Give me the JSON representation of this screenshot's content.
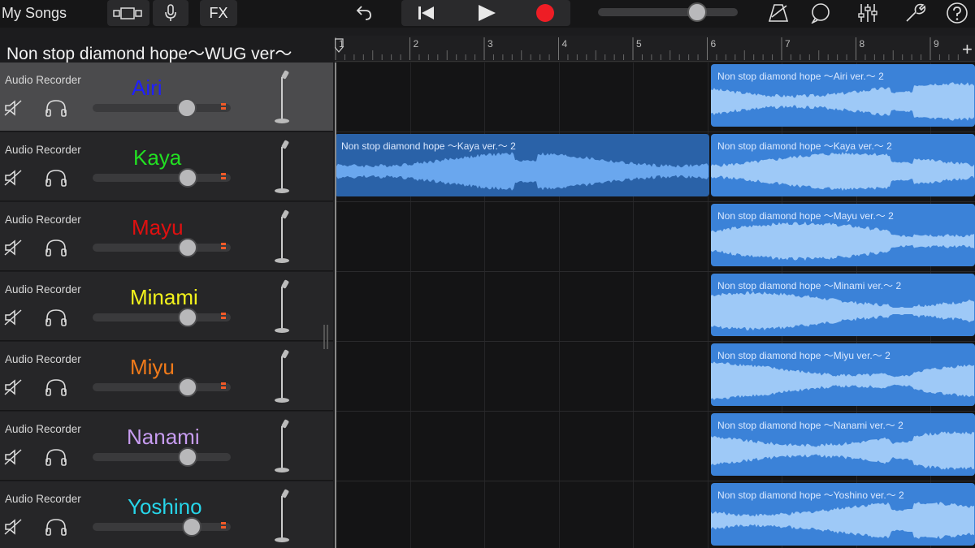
{
  "toolbar": {
    "my_songs": "My Songs",
    "fx": "FX",
    "master_volume": 0.71,
    "icons": [
      "views-icon",
      "mic-icon",
      "undo-icon",
      "go-to-start-icon",
      "play-icon",
      "record-icon",
      "metronome-icon",
      "loop-icon",
      "mixer-icon",
      "wrench-icon",
      "help-icon"
    ]
  },
  "song": {
    "title": "Non stop diamond hope〜WUG ver〜"
  },
  "ruler": {
    "bars": [
      "1",
      "2",
      "3",
      "4",
      "5",
      "6",
      "7",
      "8",
      "9"
    ],
    "add_label": "+"
  },
  "tracks": [
    {
      "type": "Audio Recorder",
      "name": "Airi",
      "name_color": "#1f1fff",
      "volume": 0.68,
      "meter": true,
      "selected": true
    },
    {
      "type": "Audio Recorder",
      "name": "Kaya",
      "name_color": "#22e022",
      "volume": 0.69,
      "meter": true,
      "selected": false
    },
    {
      "type": "Audio Recorder",
      "name": "Mayu",
      "name_color": "#e01010",
      "volume": 0.69,
      "meter": true,
      "selected": false
    },
    {
      "type": "Audio Recorder",
      "name": "Minami",
      "name_color": "#f2f21c",
      "volume": 0.69,
      "meter": true,
      "selected": false
    },
    {
      "type": "Audio Recorder",
      "name": "Miyu",
      "name_color": "#f07a1a",
      "volume": 0.69,
      "meter": true,
      "selected": false
    },
    {
      "type": "Audio Recorder",
      "name": "Nanami",
      "name_color": "#c79cf0",
      "volume": 0.69,
      "meter": false,
      "selected": false
    },
    {
      "type": "Audio Recorder",
      "name": "Yoshino",
      "name_color": "#27d6ea",
      "volume": 0.72,
      "meter": true,
      "selected": false
    }
  ],
  "regions": [
    {
      "track": 0,
      "label": "Non stop diamond hope 〜Airi ver.〜 2"
    },
    {
      "track": 1,
      "label": "Non stop diamond hope 〜Kaya ver.〜 2",
      "early": true
    },
    {
      "track": 1,
      "label": "Non stop diamond hope 〜Kaya ver.〜 2"
    },
    {
      "track": 2,
      "label": "Non stop diamond hope 〜Mayu ver.〜 2"
    },
    {
      "track": 3,
      "label": "Non stop diamond hope 〜Minami ver.〜 2"
    },
    {
      "track": 4,
      "label": "Non stop diamond hope 〜Miyu ver.〜 2"
    },
    {
      "track": 5,
      "label": "Non stop diamond hope 〜Nanami ver.〜 2"
    },
    {
      "track": 6,
      "label": "Non stop diamond hope 〜Yoshino ver.〜 2"
    }
  ]
}
